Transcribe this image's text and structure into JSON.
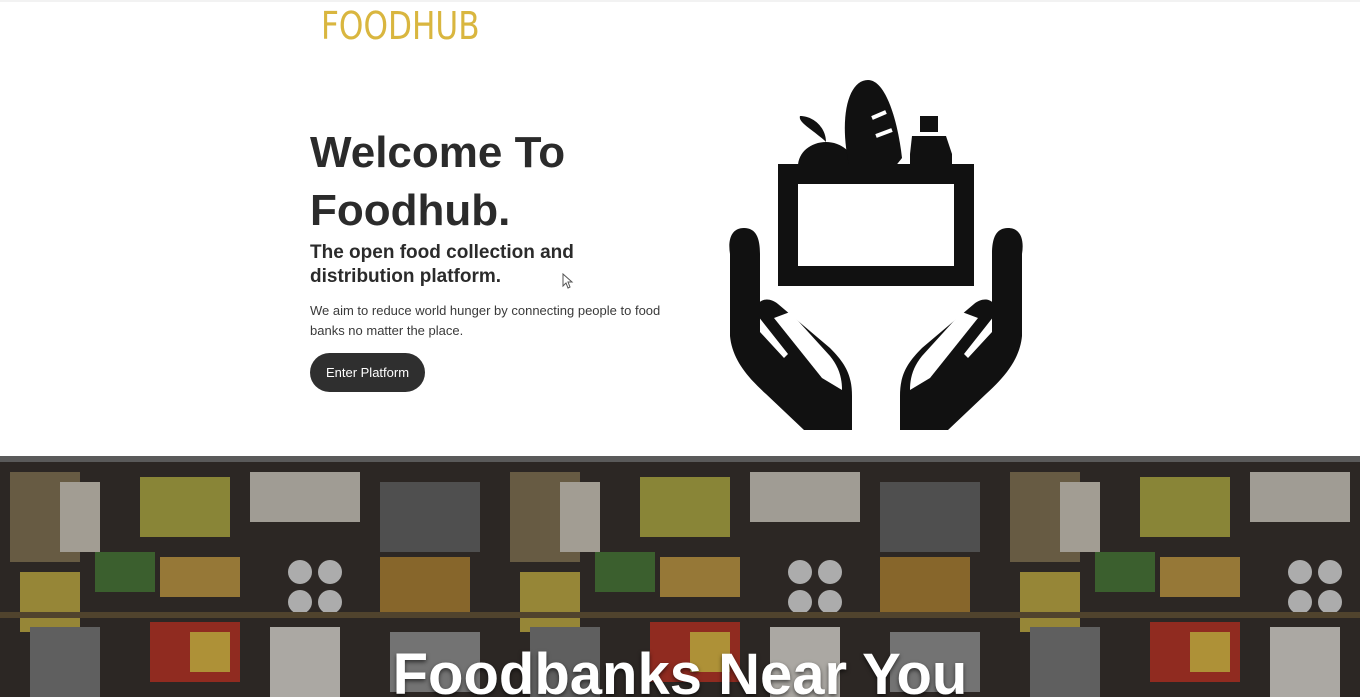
{
  "brand": {
    "logo_text": "FOODHUB",
    "logo_color": "#d9b63f"
  },
  "hero": {
    "title": "Welcome To Foodhub.",
    "subtitle": "The open food collection and distribution platform.",
    "description": "We aim to reduce world hunger by connecting people to food banks no matter the place.",
    "cta_label": "Enter Platform",
    "illustration_icon": "hands-holding-food-box-icon"
  },
  "banner": {
    "title": "Foodbanks Near You",
    "background": "food-donations-photo"
  },
  "colors": {
    "text_dark": "#2b2b2b",
    "button_bg": "#2f2f2f",
    "button_text": "#ffffff"
  }
}
